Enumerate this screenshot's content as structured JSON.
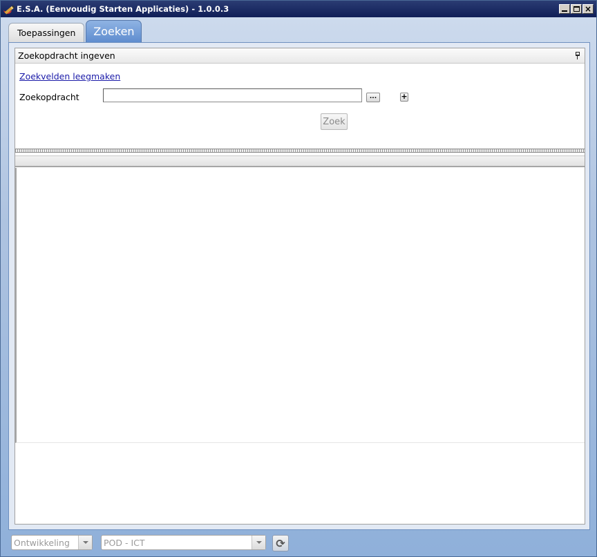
{
  "window": {
    "title": "E.S.A. (Eenvoudig Starten Applicaties) - 1.0.0.3",
    "controls": {
      "minimize": "minimize-icon",
      "maximize": "maximize-icon",
      "close": "×"
    }
  },
  "tabs": [
    {
      "label": "Toepassingen",
      "active": false
    },
    {
      "label": "Zoeken",
      "active": true
    }
  ],
  "search_panel": {
    "header": "Zoekopdracht ingeven",
    "clear_link": "Zoekvelden leegmaken",
    "query_label": "Zoekopdracht",
    "query_value": "",
    "ellipsis_label": "...",
    "add_label": "+",
    "search_button": "Zoek"
  },
  "statusbar": {
    "environment": "Ontwikkeling",
    "organisation": "POD - ICT",
    "refresh_icon": "refresh-icon"
  },
  "colors": {
    "titlebar": "#0f1e57",
    "active_tab": "#5f8dcf",
    "link": "#1a1aa8"
  }
}
